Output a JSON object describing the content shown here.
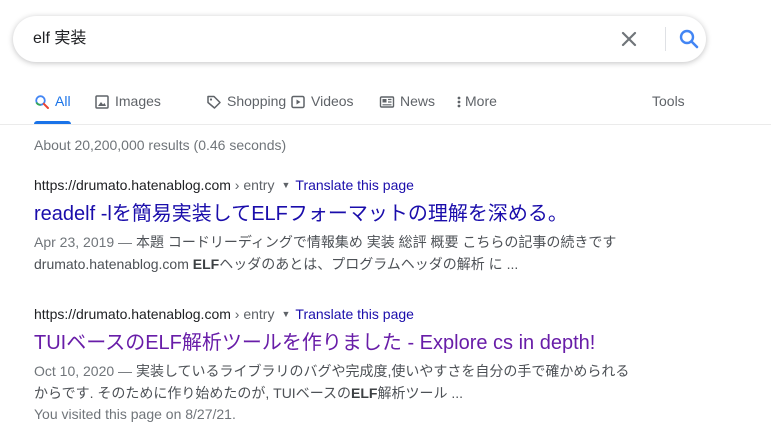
{
  "search": {
    "query": "elf 実装"
  },
  "tabs": [
    {
      "label": "All",
      "icon": "search-icon",
      "active": true
    },
    {
      "label": "Images",
      "icon": "image-icon"
    },
    {
      "label": "Shopping",
      "icon": "tag-icon"
    },
    {
      "label": "Videos",
      "icon": "play-icon"
    },
    {
      "label": "News",
      "icon": "news-icon"
    },
    {
      "label": "More",
      "icon": "more-vert-icon"
    },
    {
      "label": "Tools"
    }
  ],
  "stats": "About 20,200,000 results (0.46 seconds)",
  "results": [
    {
      "cite_url": "https://drumato.hatenablog.com",
      "cite_path": " › entry",
      "translate": "Translate this page",
      "title": "readelf -lを簡易実装してELFフォーマットの理解を深める。",
      "snippet_date": "Apr 23, 2019 — ",
      "snippet_line1": "本題 コードリーディングで情報集め 実装 総評 概要 こちらの記事の続きです",
      "snippet_line2_pre": "drumato.hatenablog.com ",
      "snippet_line2_bold": "ELF",
      "snippet_line2_post": "ヘッダのあとは、プログラムヘッダの解析 に ..."
    },
    {
      "cite_url": "https://drumato.hatenablog.com",
      "cite_path": " › entry",
      "translate": "Translate this page",
      "title": "TUIベースのELF解析ツールを作りました - Explore cs in depth!",
      "snippet_date": "Oct 10, 2020 — ",
      "snippet_line1": "実装しているライブラリのバグや完成度,使いやすさを自分の手で確かめられる",
      "snippet_line2_pre": "からです. そのために作り始めたのが, TUIベースの",
      "snippet_line2_bold": "ELF",
      "snippet_line2_post": "解析ツール ...",
      "visited": "You visited this page on 8/27/21."
    }
  ],
  "colors": {
    "accent": "#1a73e8",
    "link": "#1a0dab",
    "visited_link": "#681da8"
  }
}
